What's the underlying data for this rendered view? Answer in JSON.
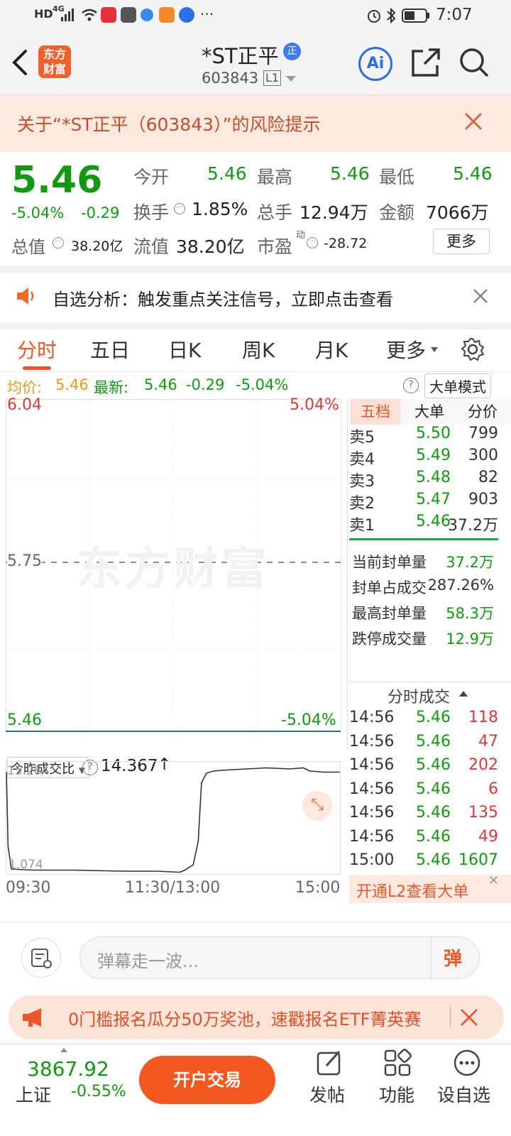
{
  "status": {
    "time": "7:07",
    "left_labels": [
      "HD",
      "4G"
    ]
  },
  "header": {
    "logo_text": "东方财富",
    "title": "*ST正平",
    "title_badge": "正",
    "code": "603843",
    "level_badge": "L1",
    "ai_label": "Ai"
  },
  "risk_notice": {
    "text": "关于“*ST正平（603843）”的风险提示"
  },
  "quote": {
    "price": "5.46",
    "change_pct": "-5.04%",
    "change": "-0.29",
    "open_label": "今开",
    "open": "5.46",
    "high_label": "最高",
    "high": "5.46",
    "low_label": "最低",
    "low": "5.46",
    "turnover_label": "换手",
    "turnover": "1.85%",
    "volume_label": "总手",
    "volume": "12.94万",
    "amount_label": "金额",
    "amount": "7066万",
    "mktcap_label": "总值",
    "mktcap": "38.20亿",
    "float_label": "流值",
    "float": "38.20亿",
    "pe_label": "市盈",
    "pe_sup": "动",
    "pe": "-28.72",
    "more_button": "更多"
  },
  "alert": {
    "text": "自选分析：触发重点关注信号，立即点击查看"
  },
  "tabs": {
    "items": [
      "分时",
      "五日",
      "日K",
      "周K",
      "月K",
      "更多"
    ],
    "active": "分时"
  },
  "infoline": {
    "avg_label": "均价:",
    "avg": "5.46",
    "latest_label": "最新:",
    "latest": "5.46",
    "latest_change": "-0.29",
    "latest_pct": "-5.04%",
    "mode_button": "大单模式"
  },
  "chart": {
    "y_top": "6.04",
    "y_top_pct": "5.04%",
    "y_mid": "5.75",
    "y_bottom": "5.46",
    "y_bottom_pct": "-5.04%",
    "watermark": "东方财富",
    "x_labels": [
      "09:30",
      "11:30/13:00",
      "15:00"
    ],
    "sub_selector": "今昨成交比",
    "sub_value": "14.367",
    "sub_max": "15.284",
    "sub_min": "1.074",
    "sub_series": [
      [
        0,
        0.95
      ],
      [
        0.5,
        0.25
      ],
      [
        1.5,
        0.04
      ],
      [
        8,
        0.03
      ],
      [
        20,
        0.03
      ],
      [
        35,
        0.02
      ],
      [
        45,
        0.02
      ],
      [
        52,
        0.01
      ],
      [
        53.5,
        0.03
      ],
      [
        56,
        0.08
      ],
      [
        57.5,
        0.3
      ],
      [
        58.5,
        0.85
      ],
      [
        60,
        0.94
      ],
      [
        62,
        0.96
      ],
      [
        66,
        0.97
      ],
      [
        72,
        0.98
      ],
      [
        78,
        0.99
      ],
      [
        85,
        0.98
      ],
      [
        89,
        0.99
      ],
      [
        91,
        0.96
      ],
      [
        95,
        0.95
      ],
      [
        100,
        0.95
      ]
    ]
  },
  "book": {
    "tabs": [
      "五档",
      "大单",
      "分价"
    ],
    "sells": [
      {
        "label": "卖5",
        "price": "5.50",
        "vol": "799"
      },
      {
        "label": "卖4",
        "price": "5.49",
        "vol": "300"
      },
      {
        "label": "卖3",
        "price": "5.48",
        "vol": "82"
      },
      {
        "label": "卖2",
        "price": "5.47",
        "vol": "903"
      },
      {
        "label": "卖1",
        "price": "5.46",
        "vol": "37.2万"
      }
    ],
    "stats": [
      {
        "label": "当前封单量",
        "value": "37.2万",
        "color": "green"
      },
      {
        "label": "封单占成交",
        "value": "287.26%",
        "color": "dark"
      },
      {
        "label": "最高封单量",
        "value": "58.3万",
        "color": "green"
      },
      {
        "label": "跌停成交量",
        "value": "12.9万",
        "color": "green"
      }
    ],
    "trades_title": "分时成交",
    "trades": [
      {
        "time": "14:56",
        "price": "5.46",
        "vol": "118",
        "color": "red"
      },
      {
        "time": "14:56",
        "price": "5.46",
        "vol": "47",
        "color": "red"
      },
      {
        "time": "14:56",
        "price": "5.46",
        "vol": "202",
        "color": "red"
      },
      {
        "time": "14:56",
        "price": "5.46",
        "vol": "6",
        "color": "red"
      },
      {
        "time": "14:56",
        "price": "5.46",
        "vol": "135",
        "color": "red"
      },
      {
        "time": "14:56",
        "price": "5.46",
        "vol": "49",
        "color": "red"
      },
      {
        "time": "15:00",
        "price": "5.46",
        "vol": "1607",
        "color": "green"
      }
    ],
    "l2_banner": "开通L2查看大单"
  },
  "chat": {
    "placeholder": "弹幕走一波...",
    "danmu_label": "弹"
  },
  "promo": {
    "text": "0门槛报名瓜分50万奖池，速戳报名ETF菁英赛"
  },
  "footer": {
    "index_value": "3867.92",
    "index_name": "上证",
    "index_change": "-0.55%",
    "trade_button": "开户交易",
    "actions": [
      "发帖",
      "功能",
      "设自选"
    ]
  }
}
